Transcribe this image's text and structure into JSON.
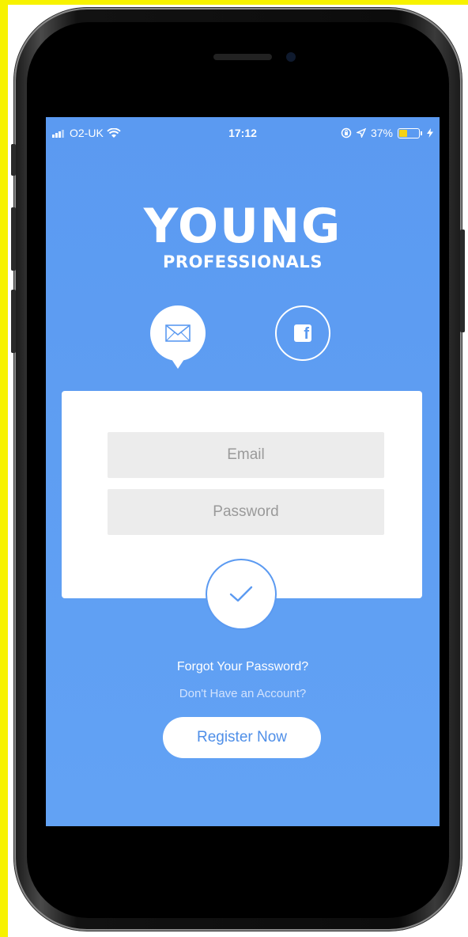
{
  "status_bar": {
    "carrier": "O2-UK",
    "time": "17:12",
    "battery_percent": "37%",
    "battery_level": 0.37,
    "icons": [
      "signal-icon",
      "wifi-icon",
      "orientation-lock-icon",
      "location-arrow-icon",
      "battery-icon",
      "charging-bolt-icon"
    ]
  },
  "logo": {
    "line1": "YOUNG",
    "line2": "PROFESSIONALS"
  },
  "auth_tabs": {
    "email_icon": "envelope-icon",
    "facebook_icon": "facebook-icon",
    "facebook_letter": "f"
  },
  "form": {
    "email_placeholder": "Email",
    "password_placeholder": "Password",
    "email_value": "",
    "password_value": "",
    "submit_icon": "checkmark-icon"
  },
  "links": {
    "forgot_password": "Forgot Your Password?",
    "no_account": "Don't Have an Account?",
    "register": "Register Now"
  },
  "colors": {
    "background": "#5b9af1",
    "accent": "#4f8fe8",
    "frame_highlight": "#f7f200",
    "battery_fill": "#f5d213"
  }
}
